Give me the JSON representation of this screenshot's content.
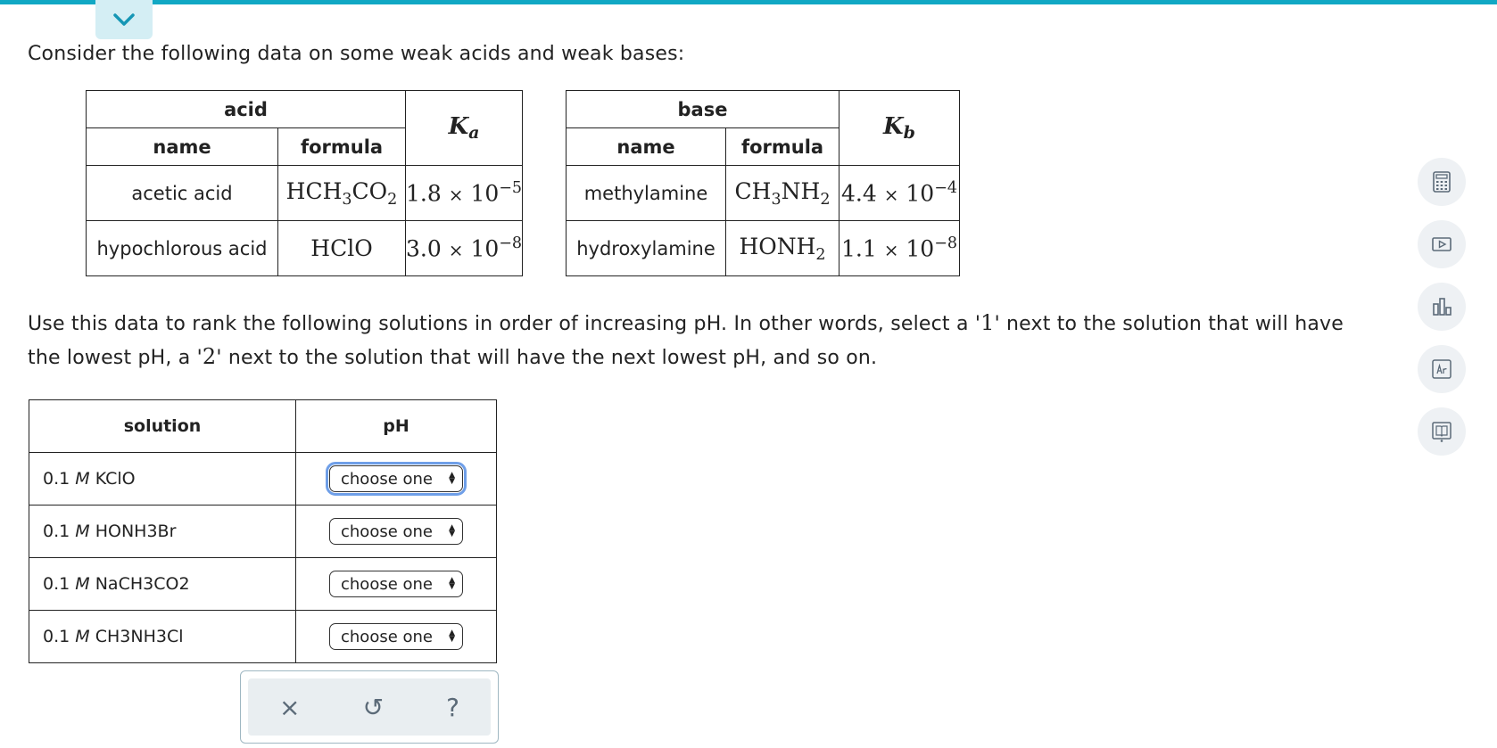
{
  "intro_text": "Consider the following data on some weak acids and weak bases:",
  "acid_table": {
    "group_header": "acid",
    "name_header": "name",
    "formula_header": "formula",
    "k_symbol": "K",
    "k_subscript": "a",
    "rows": [
      {
        "name": "acetic acid",
        "formula_parts": [
          "HCH",
          "3",
          "CO",
          "2"
        ],
        "k_mantissa": "1.8",
        "k_times": "×",
        "k_base": "10",
        "k_exp": "−5"
      },
      {
        "name": "hypochlorous acid",
        "formula_parts": [
          "HClO"
        ],
        "k_mantissa": "3.0",
        "k_times": "×",
        "k_base": "10",
        "k_exp": "−8"
      }
    ]
  },
  "base_table": {
    "group_header": "base",
    "name_header": "name",
    "formula_header": "formula",
    "k_symbol": "K",
    "k_subscript": "b",
    "rows": [
      {
        "name": "methylamine",
        "formula_parts": [
          "CH",
          "3",
          "NH",
          "2"
        ],
        "k_mantissa": "4.4",
        "k_times": "×",
        "k_base": "10",
        "k_exp": "−4"
      },
      {
        "name": "hydroxylamine",
        "formula_parts": [
          "HONH",
          "2"
        ],
        "k_mantissa": "1.1",
        "k_times": "×",
        "k_base": "10",
        "k_exp": "−8"
      }
    ]
  },
  "instructions": {
    "part1": "Use this data to rank the following solutions in order of increasing pH. In other words, select a '",
    "one": "1",
    "part2": "' next to the solution that will have the lowest pH, a '",
    "two": "2",
    "part3": "' next to the solution that will have the next lowest pH, and so on."
  },
  "solution_table": {
    "solution_header": "solution",
    "ph_header": "pH",
    "rows": [
      {
        "conc": "0.1",
        "unit": "M",
        "compound": "KClO",
        "select_value": "choose one"
      },
      {
        "conc": "0.1",
        "unit": "M",
        "compound": "HONH3Br",
        "select_value": "choose one"
      },
      {
        "conc": "0.1",
        "unit": "M",
        "compound": "NaCH3CO2",
        "select_value": "choose one"
      },
      {
        "conc": "0.1",
        "unit": "M",
        "compound": "CH3NH3Cl",
        "select_value": "choose one"
      }
    ]
  },
  "actions": {
    "clear": "×",
    "undo": "↺",
    "help": "?"
  },
  "side_tools": [
    "calculator-icon",
    "video-icon",
    "chart-icon",
    "periodic-table-icon",
    "reference-book-icon"
  ],
  "colors": {
    "accent": "#11a8c4",
    "focus": "#6f9fe8",
    "tool_bg": "#eef1f4",
    "action_icon": "#5b6a78"
  }
}
